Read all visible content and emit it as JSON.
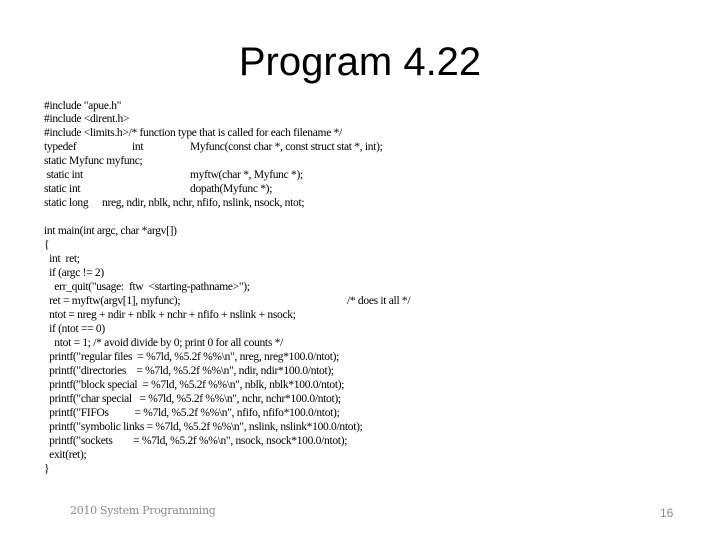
{
  "slide": {
    "title": "Program 4.22",
    "code_lines": [
      {
        "segments": [
          "#include \"apue.h\""
        ]
      },
      {
        "segments": [
          "#include <dirent.h>"
        ]
      },
      {
        "segments": [
          "#include <limits.h>/* function type that is called for each filename */"
        ]
      },
      {
        "segments": [
          "typedef",
          "int",
          "Myfunc(const char *, const struct stat *, int);"
        ]
      },
      {
        "segments": [
          "static Myfunc myfunc;"
        ]
      },
      {
        "segments": [
          " static int",
          "myftw(char *, Myfunc *);"
        ]
      },
      {
        "segments": [
          "static int",
          "dopath(Myfunc *);"
        ]
      },
      {
        "segments": [
          "static long",
          "nreg, ndir, nblk, nchr, nfifo, nslink, nsock, ntot;"
        ]
      },
      {
        "segments": [
          ""
        ]
      },
      {
        "segments": [
          "int main(int argc, char *argv[])"
        ]
      },
      {
        "segments": [
          "{"
        ]
      },
      {
        "segments": [
          "  int  ret;"
        ]
      },
      {
        "segments": [
          "  if (argc != 2)"
        ]
      },
      {
        "segments": [
          "    err_quit(\"usage:  ftw  <starting-pathname>\");"
        ]
      },
      {
        "segments": [
          "  ret = myftw(argv[1], myfunc);",
          "/* does it all */"
        ]
      },
      {
        "segments": [
          "  ntot = nreg + ndir + nblk + nchr + nfifo + nslink + nsock;"
        ]
      },
      {
        "segments": [
          "  if (ntot == 0)"
        ]
      },
      {
        "segments": [
          "    ntot = 1; /* avoid divide by 0; print 0 for all counts */"
        ]
      },
      {
        "segments": [
          "  printf(\"regular files  = %7ld, %5.2f %%\\n\", nreg, nreg*100.0/ntot);"
        ]
      },
      {
        "segments": [
          "  printf(\"directories    = %7ld, %5.2f %%\\n\", ndir, ndir*100.0/ntot);"
        ]
      },
      {
        "segments": [
          "  printf(\"block special  = %7ld, %5.2f %%\\n\", nblk, nblk*100.0/ntot);"
        ]
      },
      {
        "segments": [
          "  printf(\"char special   = %7ld, %5.2f %%\\n\", nchr, nchr*100.0/ntot);"
        ]
      },
      {
        "segments": [
          "  printf(\"FIFOs          = %7ld, %5.2f %%\\n\", nfifo, nfifo*100.0/ntot);"
        ]
      },
      {
        "segments": [
          "  printf(\"symbolic links = %7ld, %5.2f %%\\n\", nslink, nslink*100.0/ntot);"
        ]
      },
      {
        "segments": [
          "  printf(\"sockets        = %7ld, %5.2f %%\\n\", nsock, nsock*100.0/ntot);"
        ]
      },
      {
        "segments": [
          "  exit(ret);"
        ]
      },
      {
        "segments": [
          "}"
        ]
      }
    ],
    "footer_text": "2010 System Programming",
    "page_number": "16"
  }
}
